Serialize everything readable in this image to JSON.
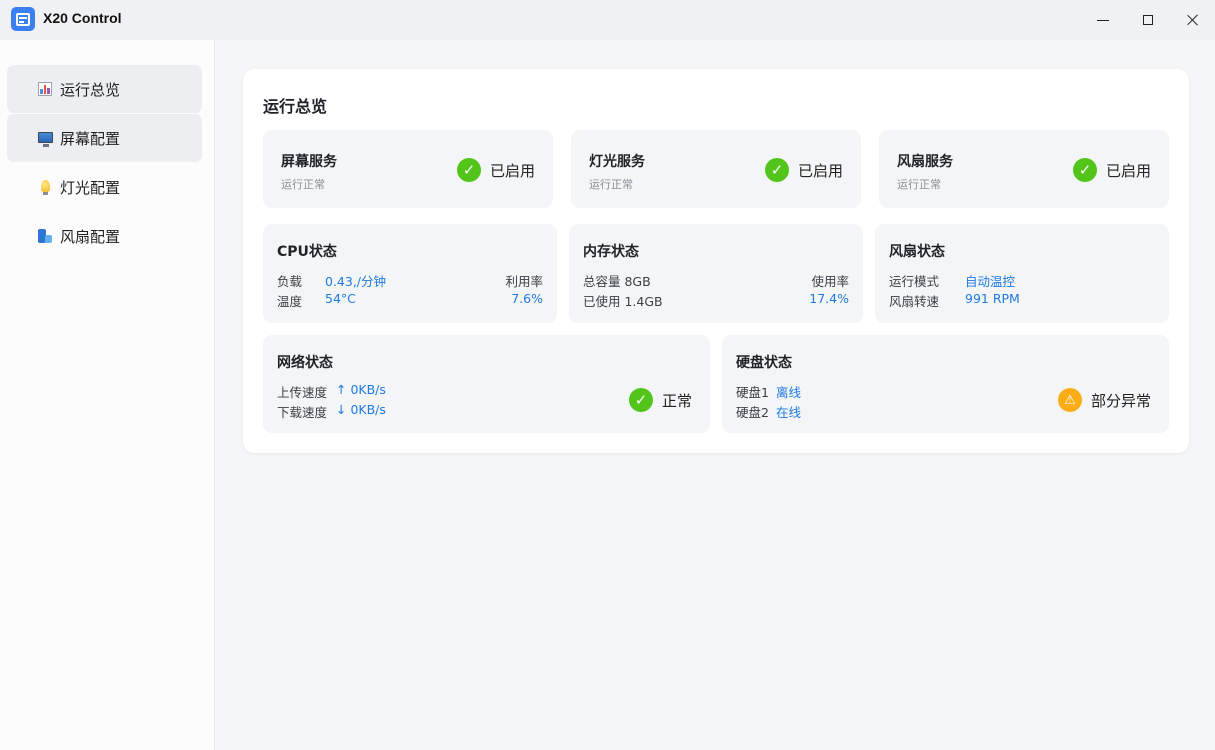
{
  "window": {
    "title": "X20 Control",
    "controls": {
      "minimize": "minimize-icon",
      "maximize": "maximize-icon",
      "close": "close-icon"
    }
  },
  "sidebar": {
    "items": [
      {
        "label": "运行总览",
        "icon": "chart-icon",
        "active": true
      },
      {
        "label": "屏幕配置",
        "icon": "monitor-icon",
        "active": false
      },
      {
        "label": "灯光配置",
        "icon": "bulb-icon",
        "active": false
      },
      {
        "label": "风扇配置",
        "icon": "fan-icon",
        "active": false
      }
    ]
  },
  "overview": {
    "title": "运行总览",
    "services": [
      {
        "name": "屏幕服务",
        "sub": "运行正常",
        "status": "已启用"
      },
      {
        "name": "灯光服务",
        "sub": "运行正常",
        "status": "已启用"
      },
      {
        "name": "风扇服务",
        "sub": "运行正常",
        "status": "已启用"
      }
    ],
    "cpu": {
      "title": "CPU状态",
      "load_label": "负载",
      "load_value": "0.43,/分钟",
      "temp_label": "温度",
      "temp_value": "54°C",
      "util_label": "利用率",
      "util_value": "7.6%"
    },
    "memory": {
      "title": "内存状态",
      "total": "总容量 8GB",
      "used": "已使用 1.4GB",
      "usage_label": "使用率",
      "usage_value": "17.4%"
    },
    "fan": {
      "title": "风扇状态",
      "mode_label": "运行模式",
      "mode_value": "自动温控",
      "speed_label": "风扇转速",
      "speed_value": "991 RPM"
    },
    "network": {
      "title": "网络状态",
      "up_label": "上传速度",
      "up_value": "↑ 0KB/s",
      "down_label": "下载速度",
      "down_value": "↓ 0KB/s",
      "status": "正常"
    },
    "disk": {
      "title": "硬盘状态",
      "disk1_label": "硬盘1",
      "disk1_value": "离线",
      "disk2_label": "硬盘2",
      "disk2_value": "在线",
      "status": "部分异常"
    }
  },
  "colors": {
    "accent": "#1f7ae0",
    "ok": "#52c41a",
    "warn": "#faad14",
    "app_icon": "#3b7ff0"
  }
}
